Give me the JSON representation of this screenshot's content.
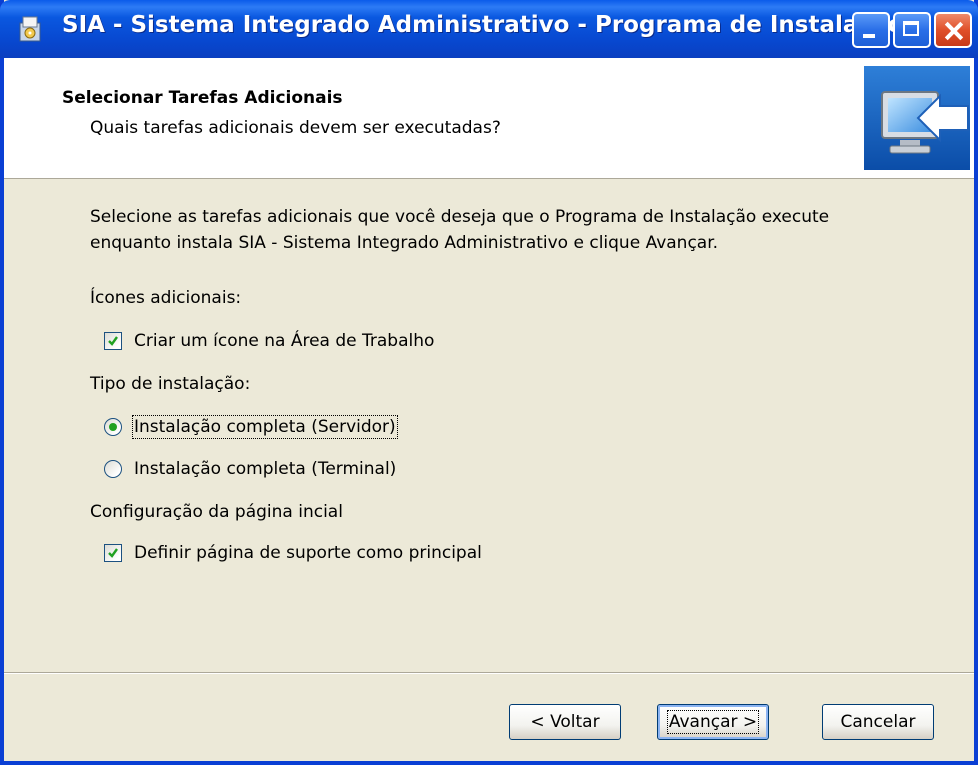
{
  "window": {
    "title": "SIA - Sistema Integrado Administrativo - Programa de Instalação",
    "colors": {
      "titlebar": "#0A58E0",
      "frame": "#0A3FD4",
      "face": "#ECE9D8",
      "radio_dot": "#21A121"
    }
  },
  "header": {
    "title": "Selecionar Tarefas Adicionais",
    "subtitle": "Quais tarefas adicionais devem ser executadas?",
    "icon": "computer-install-icon"
  },
  "content": {
    "description_line1": "Selecione as tarefas adicionais que você deseja que o Programa de Instalação execute",
    "description_line2": "enquanto instala SIA - Sistema Integrado Administrativo e clique Avançar.",
    "groups": {
      "icons": {
        "label": "Ícones adicionais:",
        "options": [
          {
            "label": "Criar um ícone na Área de Trabalho",
            "checked": true
          }
        ]
      },
      "install_type": {
        "label": "Tipo de instalação:",
        "options": [
          {
            "label": "Instalação completa (Servidor)",
            "selected": true
          },
          {
            "label": "Instalação completa (Terminal)",
            "selected": false
          }
        ]
      },
      "homepage": {
        "label": "Configuração da página incial",
        "options": [
          {
            "label": "Definir página de suporte como principal",
            "checked": true
          }
        ]
      }
    }
  },
  "buttons": {
    "back": "< Voltar",
    "next": "Avançar >",
    "cancel": "Cancelar"
  }
}
